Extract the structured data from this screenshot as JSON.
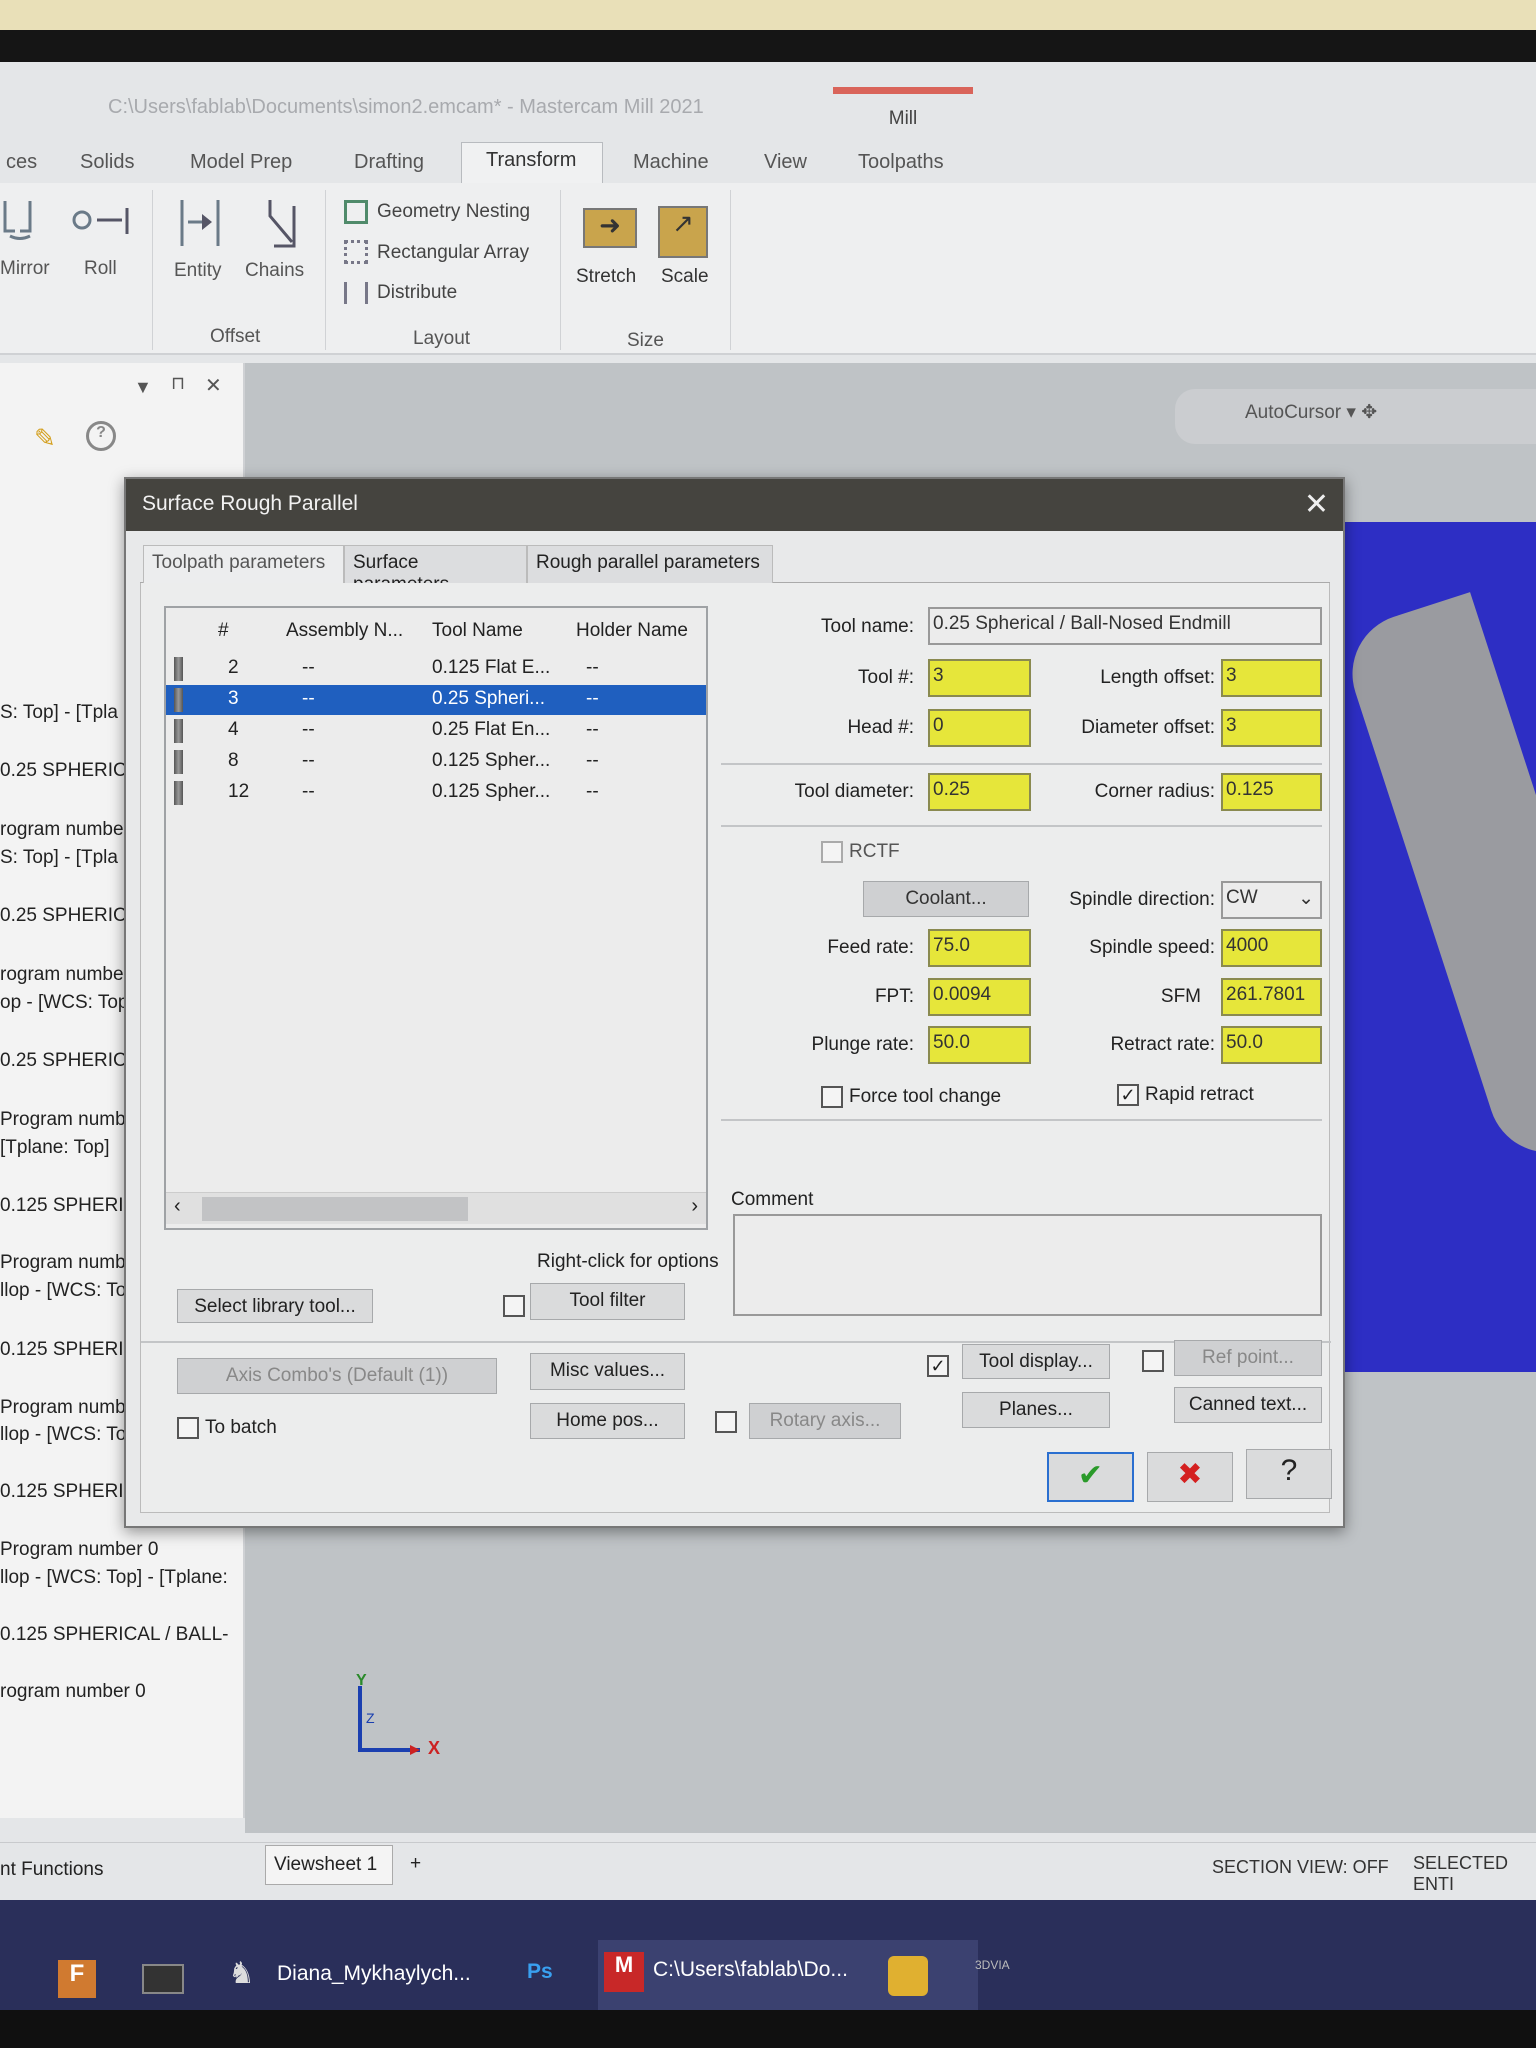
{
  "window": {
    "title": "C:\\Users\\fablab\\Documents\\simon2.emcam* - Mastercam Mill 2021",
    "context_tab": "Mill"
  },
  "ribbon": {
    "tabs": [
      "ces",
      "Solids",
      "Model Prep",
      "Drafting",
      "Transform",
      "Machine",
      "View",
      "Toolpaths"
    ],
    "active_tab": "Transform",
    "buttons": {
      "mirror": "Mirror",
      "roll": "Roll",
      "entity": "Entity",
      "chains": "Chains",
      "geometry_nesting": "Geometry Nesting",
      "rectangular_array": "Rectangular Array",
      "distribute": "Distribute",
      "stretch": "Stretch",
      "scale": "Scale"
    },
    "groups": {
      "offset": "Offset",
      "layout": "Layout",
      "size": "Size"
    }
  },
  "viewport_toolbar": {
    "autocursor": "AutoCursor"
  },
  "left_panel": {
    "lines": [
      "S: Top] - [Tpla",
      "0.25 SPHERIC",
      "rogram numbe",
      "S: Top] - [Tpla",
      "0.25 SPHERIC",
      "rogram numbe",
      "op - [WCS: Top",
      "0.25 SPHERIC",
      "Program numbe",
      "[Tplane: Top]",
      "0.125 SPHERI",
      "Program numbe",
      "llop - [WCS: Top",
      "0.125 SPHERI",
      "Program numbe",
      "llop - [WCS: Top",
      "0.125 SPHERI",
      "Program number 0",
      "llop - [WCS: Top] - [Tplane:",
      "0.125 SPHERICAL / BALL-",
      "rogram number 0"
    ]
  },
  "axes": {
    "y": "Y",
    "x": "X",
    "z": "Z"
  },
  "dialog": {
    "title": "Surface Rough Parallel",
    "tabs": [
      "Toolpath parameters",
      "Surface parameters",
      "Rough parallel parameters"
    ],
    "active_tab": "Toolpath parameters",
    "tool_list": {
      "columns": [
        "#",
        "Assembly N...",
        "Tool Name",
        "Holder Name"
      ],
      "rows": [
        {
          "num": "2",
          "assembly": "--",
          "tool": "0.125 Flat E...",
          "holder": "--"
        },
        {
          "num": "3",
          "assembly": "--",
          "tool": "0.25 Spheri...",
          "holder": "--",
          "selected": true
        },
        {
          "num": "4",
          "assembly": "--",
          "tool": "0.25 Flat En...",
          "holder": "--"
        },
        {
          "num": "8",
          "assembly": "--",
          "tool": "0.125 Spher...",
          "holder": "--"
        },
        {
          "num": "12",
          "assembly": "--",
          "tool": "0.125 Spher...",
          "holder": "--"
        }
      ]
    },
    "right_click_hint": "Right-click for options",
    "select_library_tool": "Select library tool...",
    "tool_filter": "Tool filter",
    "tool_filter_checked": false,
    "fields": {
      "tool_name_label": "Tool name:",
      "tool_name": "0.25 Spherical / Ball-Nosed Endmill",
      "tool_num_label": "Tool #:",
      "tool_num": "3",
      "length_offset_label": "Length offset:",
      "length_offset": "3",
      "head_num_label": "Head #:",
      "head_num": "0",
      "diameter_offset_label": "Diameter offset:",
      "diameter_offset": "3",
      "tool_diameter_label": "Tool diameter:",
      "tool_diameter": "0.25",
      "corner_radius_label": "Corner radius:",
      "corner_radius": "0.125",
      "rctf_label": "RCTF",
      "rctf_checked": false,
      "coolant": "Coolant...",
      "spindle_direction_label": "Spindle direction:",
      "spindle_direction": "CW",
      "feed_rate_label": "Feed rate:",
      "feed_rate": "75.0",
      "spindle_speed_label": "Spindle speed:",
      "spindle_speed": "4000",
      "fpt_label": "FPT:",
      "fpt": "0.0094",
      "sfm_label": "SFM",
      "sfm": "261.7801",
      "plunge_rate_label": "Plunge rate:",
      "plunge_rate": "50.0",
      "retract_rate_label": "Retract rate:",
      "retract_rate": "50.0",
      "force_tool_change_label": "Force tool change",
      "force_tool_change_checked": false,
      "rapid_retract_label": "Rapid retract",
      "rapid_retract_checked": true,
      "comment_label": "Comment",
      "comment": ""
    },
    "bottom": {
      "axis_combo": "Axis Combo's (Default (1))",
      "misc_values": "Misc values...",
      "tool_display": "Tool display...",
      "tool_display_checked": true,
      "ref_point": "Ref point...",
      "ref_point_checked": false,
      "to_batch": "To batch",
      "to_batch_checked": false,
      "home_pos": "Home pos...",
      "rotary_axis": "Rotary axis...",
      "rotary_checked": false,
      "planes": "Planes...",
      "canned_text": "Canned text..."
    },
    "actions": {
      "ok": "ok-icon",
      "cancel": "cancel-icon",
      "help": "?"
    }
  },
  "status_bar": {
    "left": "nt Functions",
    "viewsheet": "Viewsheet 1",
    "add_tab": "+",
    "section_view": "SECTION VIEW: OFF",
    "selected": "SELECTED ENTI"
  },
  "taskbar": {
    "items": [
      "Diana_Mykhaylych...",
      "Ps",
      "C:\\Users\\fablab\\Do...",
      "3DVIA"
    ]
  },
  "colors": {
    "field_yellow": "#e6e63a",
    "selection_blue": "#1f5fbf",
    "dialog_title": "#45443f",
    "viewport_blue": "#2d2ec4"
  }
}
